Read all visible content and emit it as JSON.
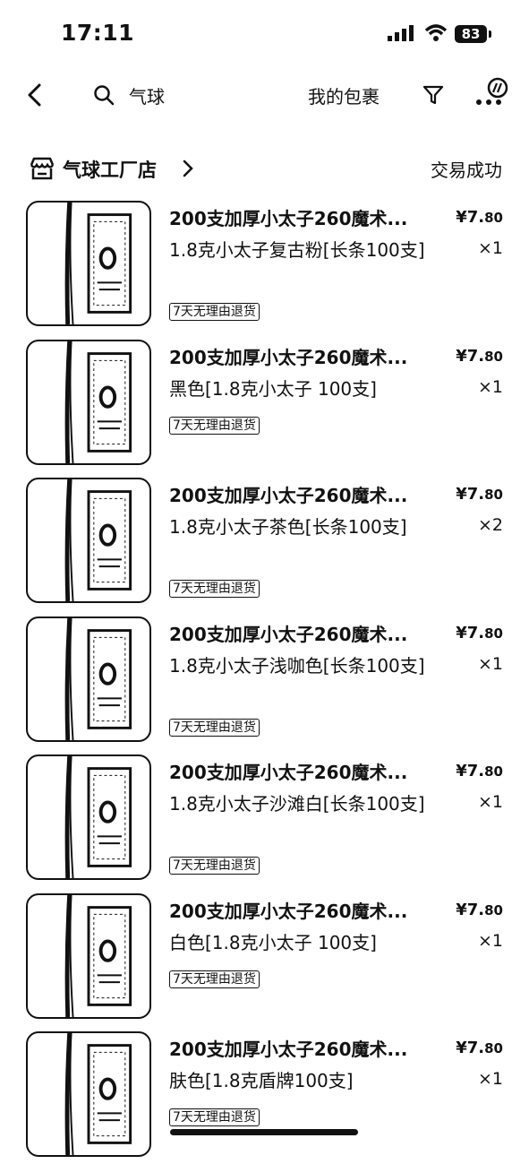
{
  "status_bar": {
    "time": "17:11",
    "battery": "83"
  },
  "nav": {
    "search_text": "气球",
    "package_label": "我的包裹"
  },
  "shop": {
    "name": "气球工厂店",
    "status": "交易成功"
  },
  "items": [
    {
      "title": "200支加厚小太子260魔术...",
      "price_main": "¥7.",
      "price_dec": "80",
      "spec": "1.8克小太子复古粉[长条100支]",
      "qty": "×1",
      "tag": "7天无理由退货"
    },
    {
      "title": "200支加厚小太子260魔术...",
      "price_main": "¥7.",
      "price_dec": "80",
      "spec": "黑色[1.8克小太子 100支]",
      "qty": "×1",
      "tag": "7天无理由退货"
    },
    {
      "title": "200支加厚小太子260魔术...",
      "price_main": "¥7.",
      "price_dec": "80",
      "spec": "1.8克小太子茶色[长条100支]",
      "qty": "×2",
      "tag": "7天无理由退货"
    },
    {
      "title": "200支加厚小太子260魔术...",
      "price_main": "¥7.",
      "price_dec": "80",
      "spec": "1.8克小太子浅咖色[长条100支]",
      "qty": "×1",
      "tag": "7天无理由退货"
    },
    {
      "title": "200支加厚小太子260魔术...",
      "price_main": "¥7.",
      "price_dec": "80",
      "spec": "1.8克小太子沙滩白[长条100支]",
      "qty": "×1",
      "tag": "7天无理由退货"
    },
    {
      "title": "200支加厚小太子260魔术...",
      "price_main": "¥7.",
      "price_dec": "80",
      "spec": "白色[1.8克小太子 100支]",
      "qty": "×1",
      "tag": "7天无理由退货"
    },
    {
      "title": "200支加厚小太子260魔术...",
      "price_main": "¥7.",
      "price_dec": "80",
      "spec": "肤色[1.8克盾牌100支]",
      "qty": "×1",
      "tag": "7天无理由退货"
    }
  ]
}
